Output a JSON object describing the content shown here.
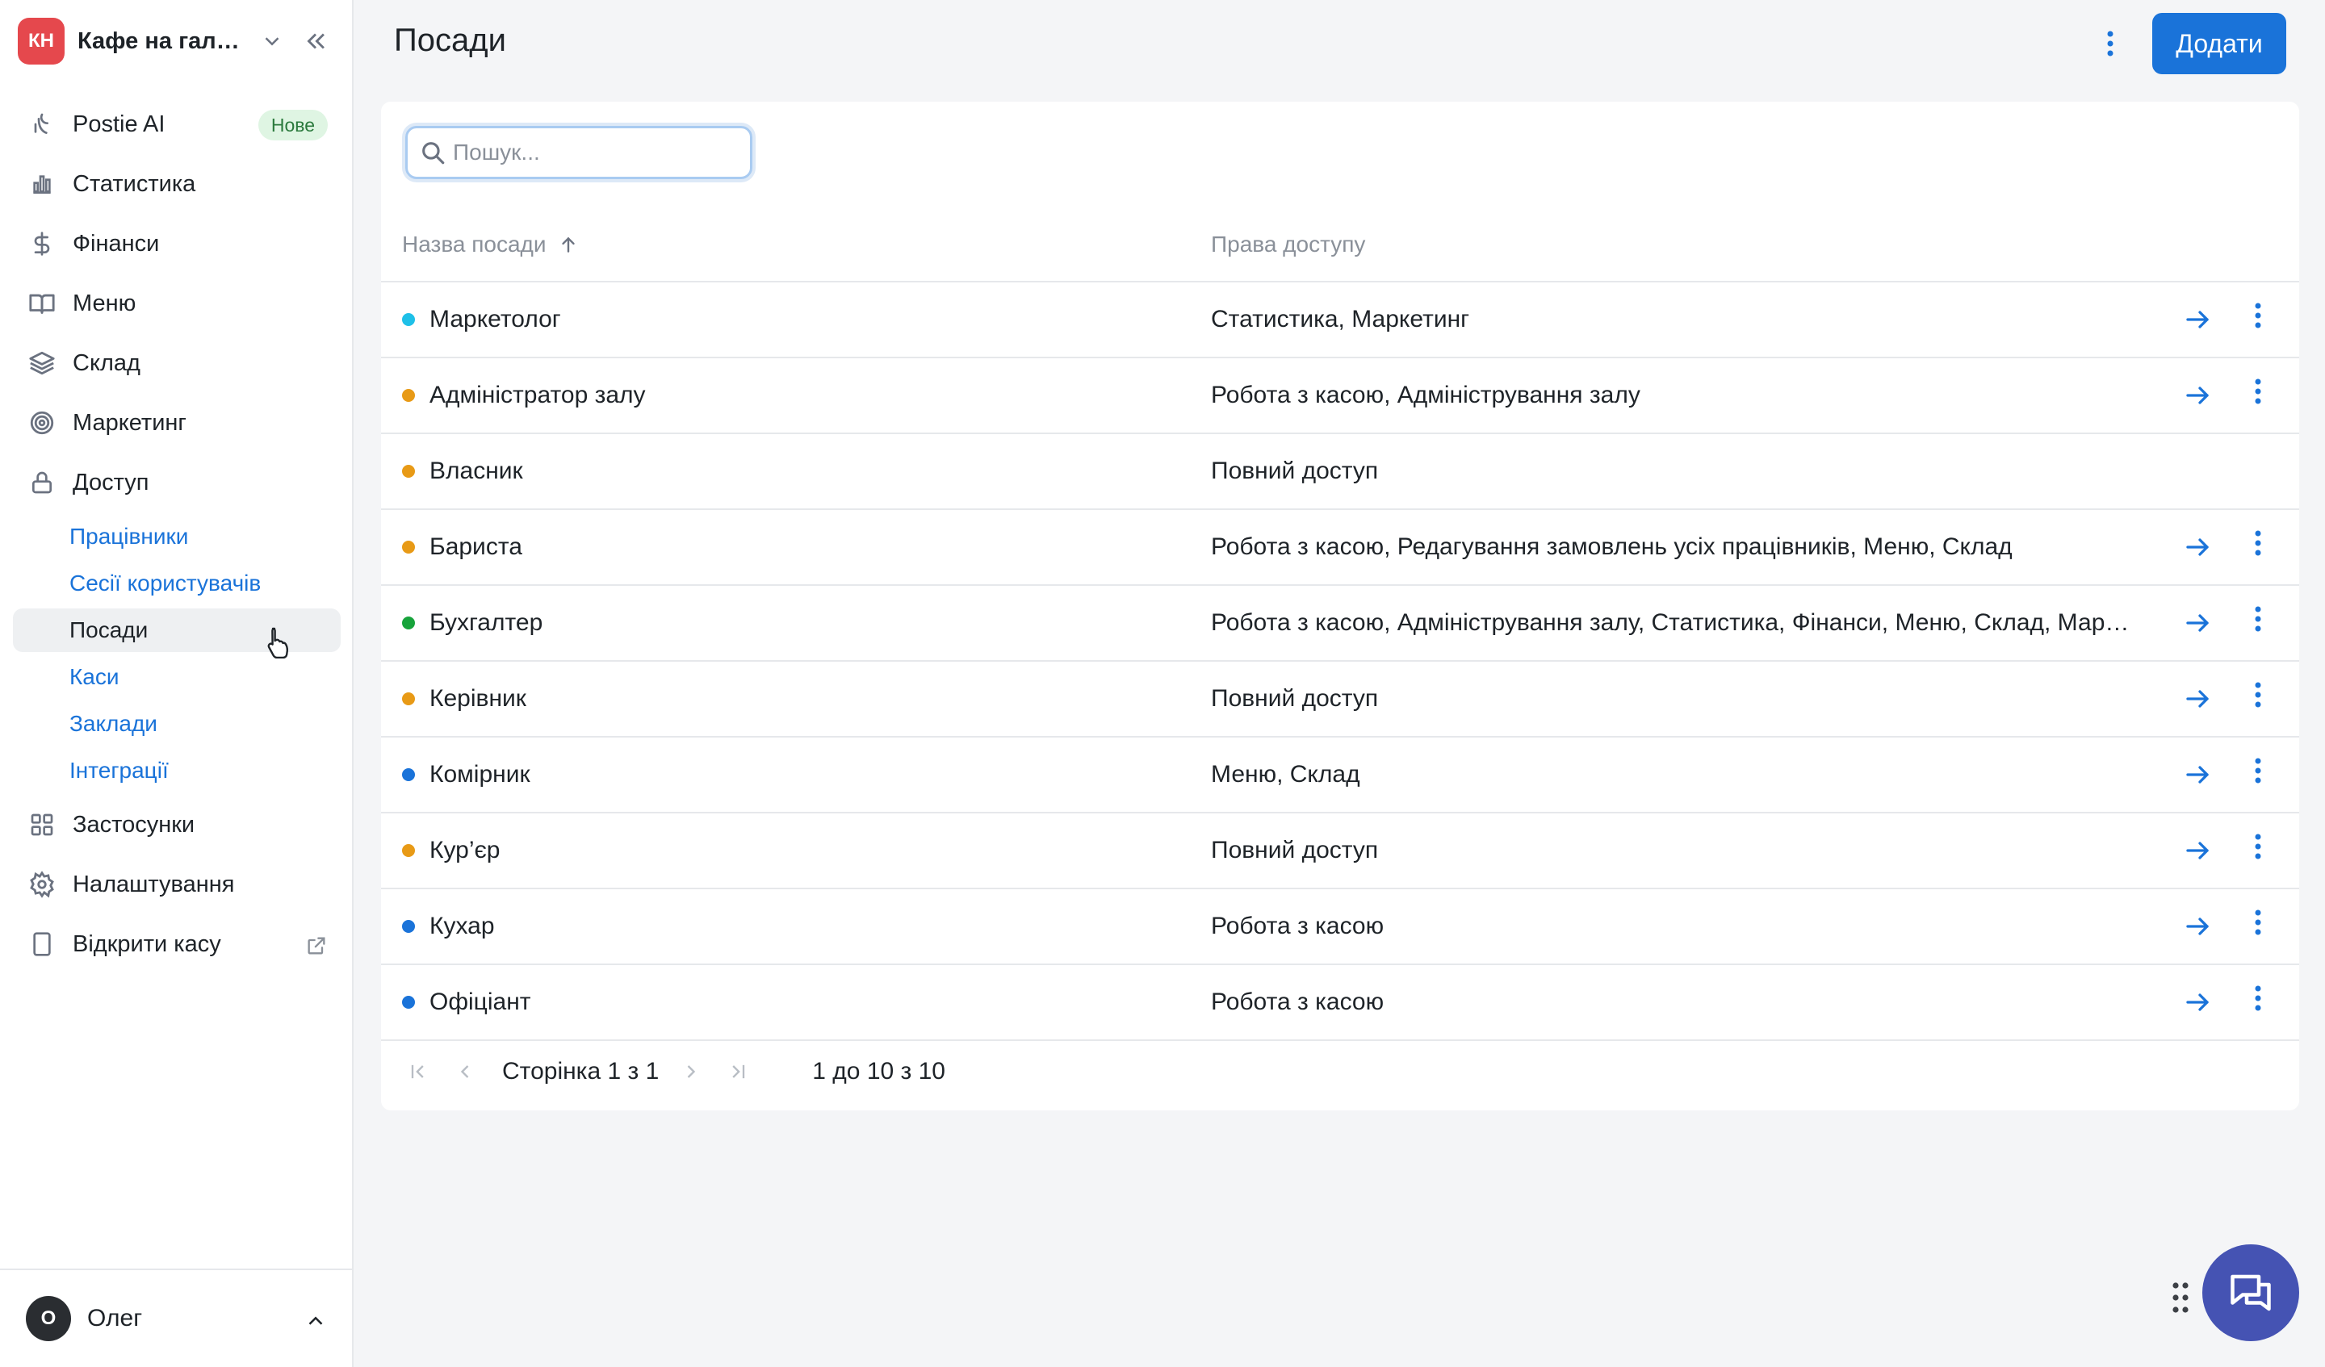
{
  "venue": {
    "initials": "КН",
    "name": "Кафе на галявині"
  },
  "nav": {
    "postie": "Postie AI",
    "postie_badge": "Нове",
    "stats": "Статистика",
    "finance": "Фінанси",
    "menu": "Меню",
    "warehouse": "Склад",
    "marketing": "Маркетинг",
    "access": "Доступ",
    "access_items": [
      "Працівники",
      "Сесії користувачів",
      "Посади",
      "Каси",
      "Заклади",
      "Інтеграції"
    ],
    "apps": "Застосунки",
    "settings": "Налаштування",
    "open_pos": "Відкрити касу"
  },
  "user": {
    "initial": "О",
    "name": "Олег"
  },
  "page": {
    "title": "Посади",
    "add_label": "Додати"
  },
  "search": {
    "placeholder": "Пошук..."
  },
  "table": {
    "columns": [
      "Назва посади",
      "Права доступу"
    ],
    "rows": [
      {
        "name": "Маркетолог",
        "permissions": "Статистика, Маркетинг",
        "color": "#1ec0e8",
        "actions": true
      },
      {
        "name": "Адміністратор залу",
        "permissions": "Робота з касою, Адміністрування залу",
        "color": "#e89a16",
        "actions": true
      },
      {
        "name": "Власник",
        "permissions": "Повний доступ",
        "color": "#e89a16",
        "actions": false
      },
      {
        "name": "Бариста",
        "permissions": "Робота з касою, Редагування замовлень усіх працівників, Меню, Склад",
        "color": "#e89a16",
        "actions": true
      },
      {
        "name": "Бухгалтер",
        "permissions": "Робота з касою, Адміністрування залу, Статистика, Фінанси, Меню, Склад, Маркетинг",
        "color": "#17a33b",
        "actions": true
      },
      {
        "name": "Керівник",
        "permissions": "Повний доступ",
        "color": "#e89a16",
        "actions": true
      },
      {
        "name": "Комірник",
        "permissions": "Меню, Склад",
        "color": "#1a73d9",
        "actions": true
      },
      {
        "name": "Кур’єр",
        "permissions": "Повний доступ",
        "color": "#e89a16",
        "actions": true
      },
      {
        "name": "Кухар",
        "permissions": "Робота з касою",
        "color": "#1a73d9",
        "actions": true
      },
      {
        "name": "Офіціант",
        "permissions": "Робота з касою",
        "color": "#1a73d9",
        "actions": true
      }
    ]
  },
  "pager": {
    "page_text": "Сторінка 1 з 1",
    "count_text": "1 до 10 з 10"
  }
}
